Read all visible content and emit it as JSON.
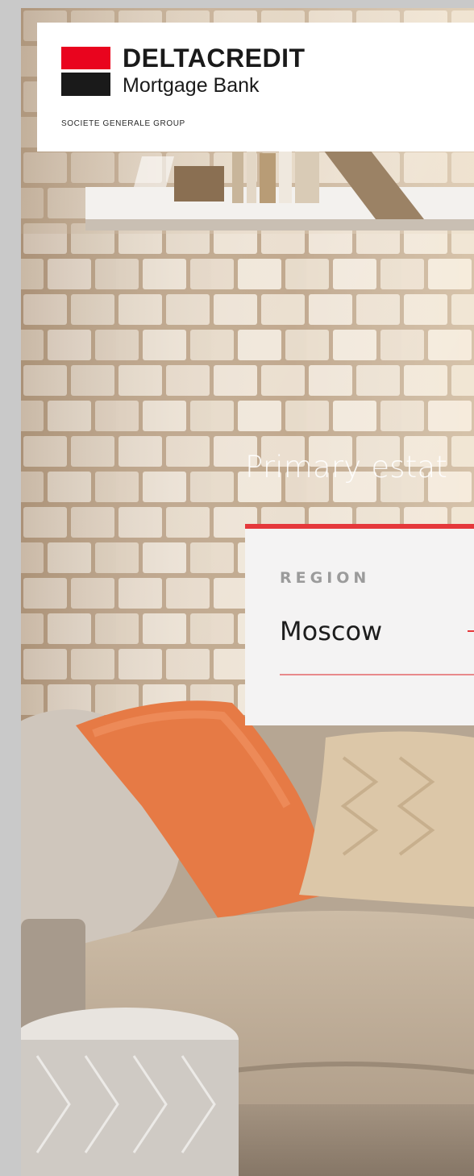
{
  "header": {
    "brand_name": "DELTACREDIT",
    "brand_subtitle": "Mortgage Bank",
    "brand_group": "SOCIETE GENERALE GROUP",
    "brand_colors": {
      "red": "#e9041e",
      "black": "#1a1a1a"
    }
  },
  "hero": {
    "title": "Primary estat"
  },
  "region_select": {
    "label": "REGION",
    "value": "Moscow",
    "accent_color": "#e5383b"
  }
}
